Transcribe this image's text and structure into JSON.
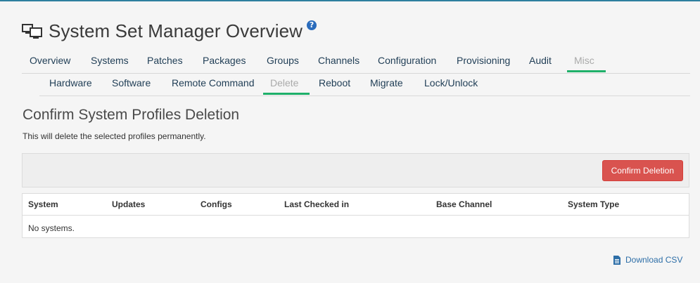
{
  "page": {
    "title": "System Set Manager Overview",
    "help_icon": "?"
  },
  "nav_primary": [
    {
      "label": "Overview",
      "active": false
    },
    {
      "label": "Systems",
      "active": false
    },
    {
      "label": "Patches",
      "active": false
    },
    {
      "label": "Packages",
      "active": false
    },
    {
      "label": "Groups",
      "active": false
    },
    {
      "label": "Channels",
      "active": false
    },
    {
      "label": "Configuration",
      "active": false
    },
    {
      "label": "Provisioning",
      "active": false
    },
    {
      "label": "Audit",
      "active": false
    },
    {
      "label": "Misc",
      "active": true
    }
  ],
  "nav_secondary": [
    {
      "label": "Hardware",
      "active": false
    },
    {
      "label": "Software",
      "active": false
    },
    {
      "label": "Remote Command",
      "active": false
    },
    {
      "label": "Delete",
      "active": true
    },
    {
      "label": "Reboot",
      "active": false
    },
    {
      "label": "Migrate",
      "active": false
    },
    {
      "label": "Lock/Unlock",
      "active": false
    }
  ],
  "section": {
    "title": "Confirm System Profiles Deletion",
    "description": "This will delete the selected profiles permanently."
  },
  "actions": {
    "confirm_label": "Confirm Deletion"
  },
  "table": {
    "columns": [
      "System",
      "Updates",
      "Configs",
      "Last Checked in",
      "Base Channel",
      "System Type"
    ],
    "empty_message": "No systems."
  },
  "footer": {
    "download_label": "Download CSV"
  },
  "colors": {
    "active_underline": "#1fb06a",
    "danger": "#d9534f",
    "link": "#2d6ea7"
  }
}
